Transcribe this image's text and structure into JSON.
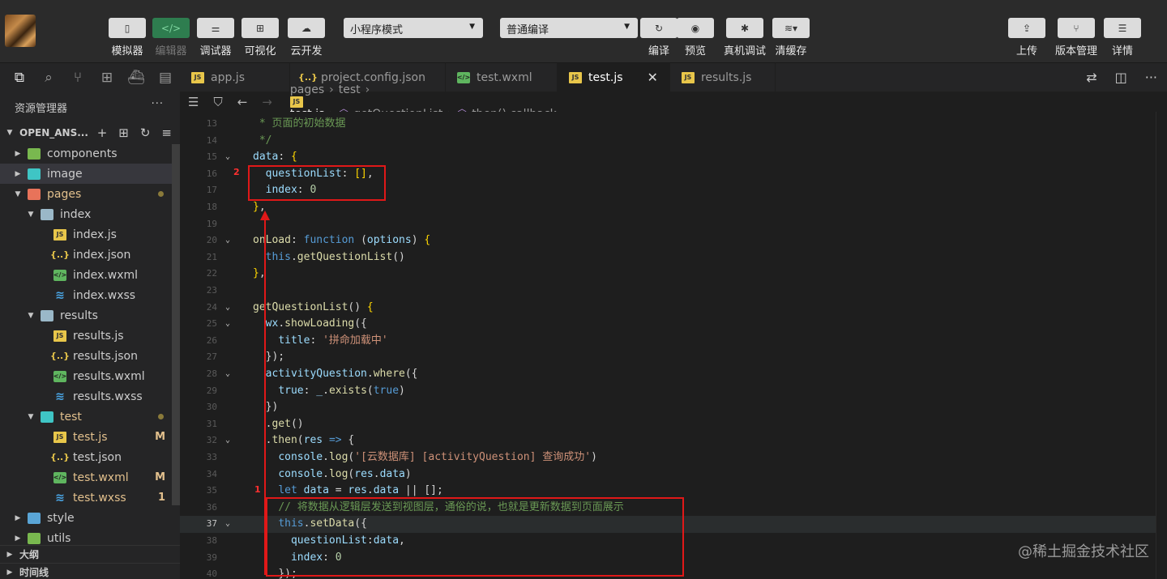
{
  "toolbar": {
    "simulator": "模拟器",
    "editor": "编辑器",
    "debugger": "调试器",
    "visual": "可视化",
    "cloud": "云开发",
    "mode_select": "小程序模式",
    "compile_select": "普通编译",
    "compile": "编译",
    "preview": "预览",
    "real_debug": "真机调试",
    "clear_cache": "清缓存",
    "upload": "上传",
    "version": "版本管理",
    "details": "详情"
  },
  "explorer": {
    "title": "资源管理器",
    "more": "···",
    "project": "OPEN_ANS...",
    "tree": [
      {
        "label": "components",
        "depth": 0,
        "type": "folder",
        "color": "green",
        "open": false
      },
      {
        "label": "image",
        "depth": 0,
        "type": "folder",
        "color": "teal",
        "open": false,
        "selected": true
      },
      {
        "label": "pages",
        "depth": 0,
        "type": "folder",
        "color": "red",
        "open": true,
        "dot": true,
        "labelColor": "#e2c08d"
      },
      {
        "label": "index",
        "depth": 1,
        "type": "folder",
        "color": "plain",
        "open": true
      },
      {
        "label": "index.js",
        "depth": 2,
        "type": "js"
      },
      {
        "label": "index.json",
        "depth": 2,
        "type": "json"
      },
      {
        "label": "index.wxml",
        "depth": 2,
        "type": "wxml"
      },
      {
        "label": "index.wxss",
        "depth": 2,
        "type": "wxss"
      },
      {
        "label": "results",
        "depth": 1,
        "type": "folder",
        "color": "plain",
        "open": true
      },
      {
        "label": "results.js",
        "depth": 2,
        "type": "js"
      },
      {
        "label": "results.json",
        "depth": 2,
        "type": "json"
      },
      {
        "label": "results.wxml",
        "depth": 2,
        "type": "wxml"
      },
      {
        "label": "results.wxss",
        "depth": 2,
        "type": "wxss"
      },
      {
        "label": "test",
        "depth": 1,
        "type": "folder",
        "color": "teal",
        "open": true,
        "dot": true,
        "labelColor": "#e2c08d"
      },
      {
        "label": "test.js",
        "depth": 2,
        "type": "js",
        "badge": "M",
        "labelColor": "#e2c08d"
      },
      {
        "label": "test.json",
        "depth": 2,
        "type": "json"
      },
      {
        "label": "test.wxml",
        "depth": 2,
        "type": "wxml",
        "badge": "M",
        "labelColor": "#e2c08d"
      },
      {
        "label": "test.wxss",
        "depth": 2,
        "type": "wxss",
        "badge": "1",
        "labelColor": "#e2c08d"
      },
      {
        "label": "style",
        "depth": 0,
        "type": "folder",
        "color": "blue",
        "open": false
      },
      {
        "label": "utils",
        "depth": 0,
        "type": "folder",
        "color": "green",
        "open": false
      }
    ],
    "outline": "大纲",
    "timeline": "时间线"
  },
  "tabs": [
    {
      "label": "app.js",
      "type": "js"
    },
    {
      "label": "project.config.json",
      "type": "json"
    },
    {
      "label": "test.wxml",
      "type": "wxml"
    },
    {
      "label": "test.js",
      "type": "js",
      "active": true
    },
    {
      "label": "results.js",
      "type": "js"
    }
  ],
  "breadcrumb": [
    "pages",
    "test",
    "test.js",
    "getQuestionList",
    "then() callback"
  ],
  "code": [
    {
      "n": "13",
      "html": "<span class='c'> * 页面的初始数据</span>"
    },
    {
      "n": "14",
      "html": "<span class='c'> */</span>"
    },
    {
      "n": "15",
      "html": "<span class='v'>data</span><span class='o'>: </span><span class='y'>{</span>",
      "fold": true
    },
    {
      "n": "16",
      "html": "  <span class='v'>questionList</span><span class='o'>: </span><span class='y'>[]</span><span class='o'>,</span>"
    },
    {
      "n": "17",
      "html": "  <span class='v'>index</span><span class='o'>: </span><span class='n'>0</span>"
    },
    {
      "n": "18",
      "html": "<span class='y'>}</span><span class='o'>,</span>"
    },
    {
      "n": "19",
      "html": ""
    },
    {
      "n": "20",
      "html": "<span class='f'>onLoad</span><span class='o'>: </span><span class='k'>function</span><span class='o'> (</span><span class='p'>options</span><span class='o'>) </span><span class='y'>{</span>",
      "fold": true
    },
    {
      "n": "21",
      "html": "  <span class='k'>this</span><span class='o'>.</span><span class='f'>getQuestionList</span><span class='o'>()</span>"
    },
    {
      "n": "22",
      "html": "<span class='y'>}</span><span class='o'>,</span>"
    },
    {
      "n": "23",
      "html": ""
    },
    {
      "n": "24",
      "html": "<span class='f'>getQuestionList</span><span class='o'>() </span><span class='y'>{</span>",
      "fold": true
    },
    {
      "n": "25",
      "html": "  <span class='v'>wx</span><span class='o'>.</span><span class='f'>showLoading</span><span class='o'>({</span>",
      "fold": true
    },
    {
      "n": "26",
      "html": "    <span class='v'>title</span><span class='o'>: </span><span class='s'>'拼命加载中'</span>"
    },
    {
      "n": "27",
      "html": "  <span class='o'>});</span>"
    },
    {
      "n": "28",
      "html": "  <span class='v'>activityQuestion</span><span class='o'>.</span><span class='f'>where</span><span class='o'>({</span>",
      "fold": true
    },
    {
      "n": "29",
      "html": "    <span class='v'>true</span><span class='o'>: </span><span class='v'>_</span><span class='o'>.</span><span class='f'>exists</span><span class='o'>(</span><span class='k'>true</span><span class='o'>)</span>"
    },
    {
      "n": "30",
      "html": "  <span class='o'>})</span>"
    },
    {
      "n": "31",
      "html": "  <span class='o'>.</span><span class='f'>get</span><span class='o'>()</span>"
    },
    {
      "n": "32",
      "html": "  <span class='o'>.</span><span class='f'>then</span><span class='o'>(</span><span class='p'>res</span><span class='o'> </span><span class='k'>=&gt;</span><span class='o'> {</span>",
      "fold": true
    },
    {
      "n": "33",
      "html": "    <span class='v'>console</span><span class='o'>.</span><span class='f'>log</span><span class='o'>(</span><span class='s'>'[云数据库] [activityQuestion] 查询成功'</span><span class='o'>)</span>"
    },
    {
      "n": "34",
      "html": "    <span class='v'>console</span><span class='o'>.</span><span class='f'>log</span><span class='o'>(</span><span class='v'>res</span><span class='o'>.</span><span class='v'>data</span><span class='o'>)</span>"
    },
    {
      "n": "35",
      "html": "    <span class='k'>let</span><span class='o'> </span><span class='v'>data</span><span class='o'> = </span><span class='v'>res</span><span class='o'>.</span><span class='v'>data</span><span class='o'> || [];</span>"
    },
    {
      "n": "36",
      "html": "    <span class='c'>// 将数据从逻辑层发送到视图层，通俗的说，也就是更新数据到页面展示</span>"
    },
    {
      "n": "37",
      "html": "    <span class='k'>this</span><span class='o'>.</span><span class='f'>setData</span><span class='o'>({</span>",
      "fold": true,
      "current": true
    },
    {
      "n": "38",
      "html": "      <span class='v'>questionList</span><span class='o'>:</span><span class='v'>data</span><span class='o'>,</span>"
    },
    {
      "n": "39",
      "html": "      <span class='v'>index</span><span class='o'>: </span><span class='n'>0</span>"
    },
    {
      "n": "40",
      "html": "    <span class='o'>});</span>"
    }
  ],
  "annotations": {
    "label_top": "2",
    "label_bottom": "1"
  },
  "watermark": "@稀土掘金技术社区",
  "colors": {
    "annotation": "#e01818",
    "accent_green": "#2e7d4f"
  }
}
